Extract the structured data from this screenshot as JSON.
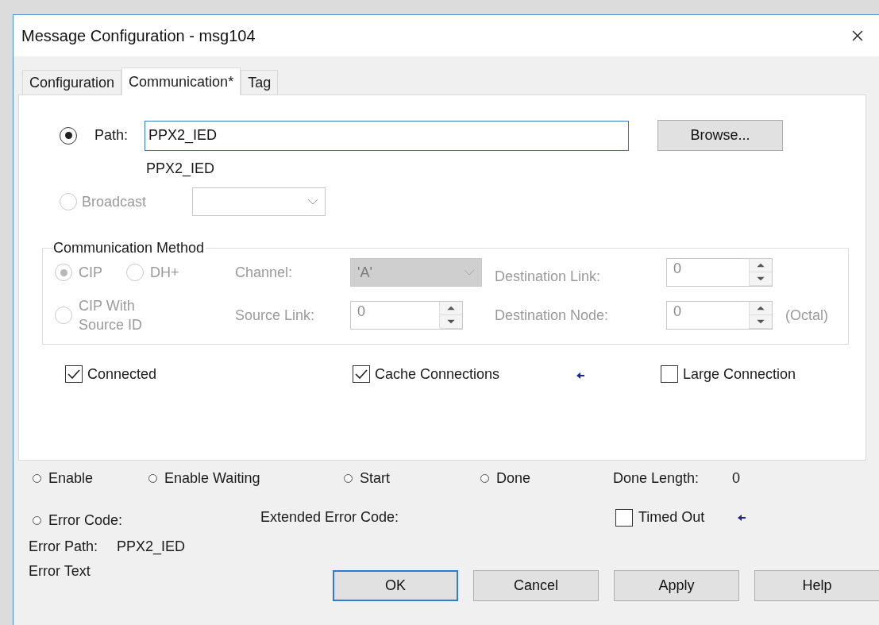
{
  "window": {
    "title": "Message Configuration - msg104"
  },
  "tabs": [
    {
      "label": "Configuration",
      "selected": false
    },
    {
      "label": "Communication*",
      "selected": true
    },
    {
      "label": "Tag",
      "selected": false
    }
  ],
  "path": {
    "label": "Path:",
    "selected": true,
    "value": "PPX2_IED",
    "resolved": "PPX2_IED",
    "browse": "Browse..."
  },
  "broadcast": {
    "label": "Broadcast",
    "selected": false,
    "disabled": true
  },
  "communication_method": {
    "title": "Communication Method",
    "disabled": true,
    "options": [
      {
        "label": "CIP",
        "selected": true
      },
      {
        "label": "DH+",
        "selected": false
      },
      {
        "label": "CIP With Source ID",
        "selected": false
      }
    ],
    "channel": {
      "label": "Channel:",
      "value": "'A'"
    },
    "source_link": {
      "label": "Source Link:",
      "value": "0"
    },
    "destination_link": {
      "label": "Destination Link:",
      "value": "0"
    },
    "destination_node": {
      "label": "Destination Node:",
      "value": "0",
      "unit": "(Octal)"
    }
  },
  "options": [
    {
      "label": "Connected",
      "checked": true
    },
    {
      "label": "Cache Connections",
      "checked": true
    },
    {
      "label": "Large Connection",
      "checked": false
    }
  ],
  "status": {
    "indicators": [
      {
        "label": "Enable",
        "on": false
      },
      {
        "label": "Enable Waiting",
        "on": false
      },
      {
        "label": "Start",
        "on": false
      },
      {
        "label": "Done",
        "on": false
      }
    ],
    "done_length": {
      "label": "Done Length:",
      "value": "0"
    },
    "error_code": {
      "label": "Error Code:",
      "on": false
    },
    "extended_error_code": {
      "label": "Extended Error Code:"
    },
    "timed_out": {
      "label": "Timed Out",
      "checked": false
    },
    "error_path": {
      "label": "Error Path:",
      "value": "PPX2_IED"
    },
    "error_text": {
      "label": "Error Text"
    }
  },
  "buttons": [
    {
      "label": "OK",
      "default": true
    },
    {
      "label": "Cancel",
      "default": false
    },
    {
      "label": "Apply",
      "default": false
    },
    {
      "label": "Help",
      "default": false
    }
  ]
}
